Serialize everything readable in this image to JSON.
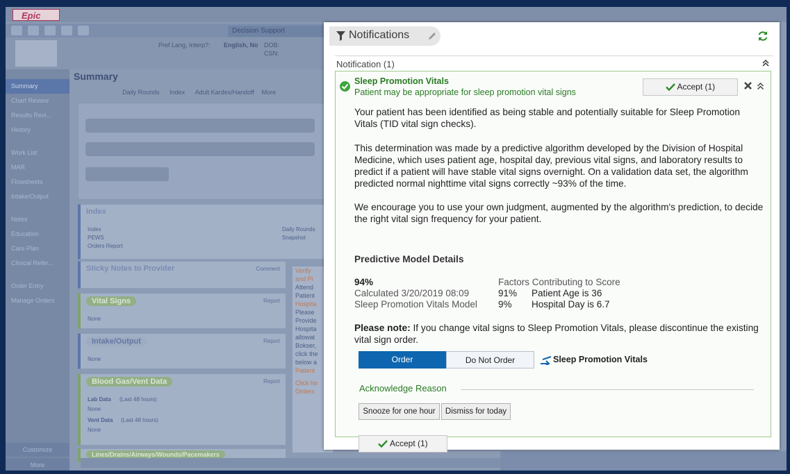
{
  "app": {
    "logo": "Epic"
  },
  "background": {
    "tab_label": "Decision Support",
    "patient": {
      "pref_lang_label": "Pref Lang, Interp?:",
      "pref_lang_value": "English, No",
      "dob_label": "DOB:",
      "csn_label": "CSN:"
    },
    "nav_items": [
      "Summary",
      "Chart Review",
      "Results Revi...",
      "History",
      "Work List",
      "MAR",
      "Flowsheets",
      "Intake/Output",
      "Notes",
      "Education",
      "Care Plan",
      "Clinical Refer...",
      "Order Entry",
      "Manage Orders"
    ],
    "nav_customize": "Customize",
    "nav_more": "More",
    "summary_title": "Summary",
    "summary_tabs": [
      "Daily Rounds",
      "Index",
      "Adult Kardex/Handoff",
      "More"
    ],
    "index_card": {
      "title": "Index",
      "left": [
        "Index",
        "PEWS",
        "Orders Report"
      ],
      "right": [
        "Daily Rounds",
        "Snapshot"
      ]
    },
    "sticky": {
      "title": "Sticky Notes to Provider",
      "link": "Comment"
    },
    "vitals": {
      "title": "Vital Signs",
      "link": "Report",
      "value": "None"
    },
    "intake": {
      "title": "Intake/Output",
      "link": "Report",
      "value": "None"
    },
    "bloodgas": {
      "title": "Blood Gas/Vent Data",
      "link": "Report",
      "lab_label": "Lab Data",
      "lab_sub": "(Last 48 hours)",
      "lab_value": "None",
      "vent_label": "Vent Data",
      "vent_sub": "(Last 48 hours)",
      "vent_value": "None"
    },
    "lines_title": "Lines/Drains/Airways/Wounds/Pacemakers",
    "right_col": [
      "Verify",
      "and Pi",
      "Attend",
      "Patient",
      "Hospita",
      "Please",
      "Provide",
      "Hospita",
      "allowat",
      "Bokser,",
      "click the",
      "below a",
      "Patient",
      "Click he",
      "Orders"
    ]
  },
  "notifications": {
    "header_title": "Notifications",
    "count_label": "Notification (1)",
    "card": {
      "title": "Sleep Promotion Vitals",
      "subtitle": "Patient may be appropriate for sleep promotion vital signs",
      "accept_label": "Accept (1)",
      "para1": "Your patient has been identified as being stable and potentially suitable for Sleep Promotion Vitals (TID vital sign checks).",
      "para2": "This determination was made by a predictive algorithm developed by the Division of Hospital Medicine, which uses patient age, hospital day, previous vital signs, and laboratory results to predict if a patient will have stable vital signs overnight. On a validation data set, the algorithm predicted normal nighttime vital signs correctly ~93% of the time.",
      "para3": "We encourage you to use your own judgment, augmented by the algorithm's prediction, to decide the right vital sign frequency for your patient.",
      "model": {
        "title": "Predictive Model Details",
        "score": "94%",
        "calculated": "Calculated 3/20/2019 08:09",
        "model_name": "Sleep Promotion Vitals Model",
        "factors_header": "Factors Contributing to Score",
        "factors": [
          {
            "pct": "91%",
            "label": "Patient Age is 36"
          },
          {
            "pct": "9%",
            "label": "Hospital Day is 6.7"
          }
        ]
      },
      "note_bold": "Please note:",
      "note_text": " If you change vital signs to Sleep Promotion Vitals, please discontinue the existing vital sign order.",
      "order_label": "Order",
      "do_not_order_label": "Do Not Order",
      "order_item": "Sleep Promotion Vitals",
      "ack_reason_label": "Acknowledge Reason",
      "snooze_label": "Snooze for one hour",
      "dismiss_label": "Dismiss for today",
      "accept_bottom_label": "Accept (1)"
    }
  },
  "colors": {
    "accent_green": "#2a7a23",
    "order_blue": "#0e66b0",
    "card_border": "#9ccb8a"
  }
}
